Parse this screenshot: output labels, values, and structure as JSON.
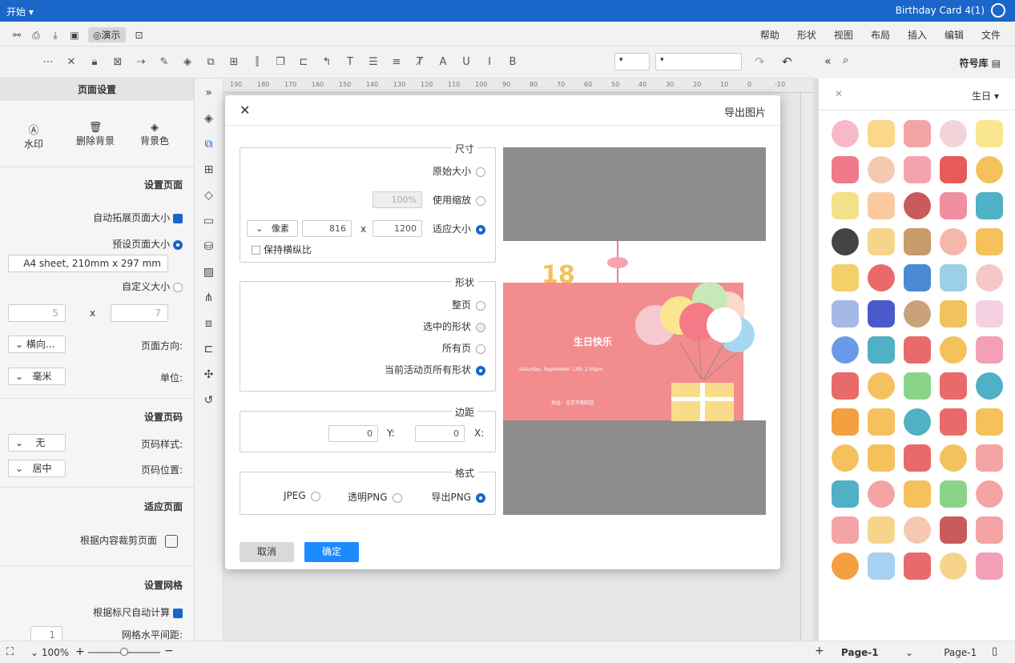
{
  "titlebar": {
    "left_label": "开始",
    "doc_title": "Birthday Card 4(1)"
  },
  "menubar": {
    "items": [
      "文件",
      "编辑",
      "插入",
      "布局",
      "视图",
      "形状",
      "帮助"
    ],
    "demo_label": "演示"
  },
  "toolbar": {
    "font_placeholder": ""
  },
  "library": {
    "title": "符号库",
    "category": "生日"
  },
  "left_panel": {
    "title": "页面设置",
    "bg_color": "背景色",
    "remove_bg": "删除背景",
    "watermark": "水印",
    "set_page": "设置页面",
    "auto_expand": "自动拓展页面大小",
    "preset_size": "预设页面大小",
    "preset_value": "A4 sheet, 210mm x 297 mm",
    "custom_size": "自定义大小",
    "custom_w": "7",
    "custom_h": "5",
    "orientation_label": "页面方向:",
    "orientation_value": "横向...",
    "unit_label": "单位:",
    "unit_value": "毫米",
    "page_number": "设置页码",
    "page_style_label": "页码样式:",
    "page_style_value": "无",
    "page_pos_label": "页码位置:",
    "page_pos_value": "居中",
    "fit_page": "适应页面",
    "crop_content": "根据内容裁剪页面",
    "grid": "设置网格",
    "auto_ruler": "根据标尺自动计算",
    "grid_spacing": "网格水平间距:",
    "grid_spacing_value": "1"
  },
  "dialog": {
    "title": "导出图片",
    "size_legend": "尺寸",
    "original_size": "原始大小",
    "use_scale": "使用缩放",
    "scale_value": "100%",
    "fit_size": "适应大小",
    "width": "1200",
    "height": "816",
    "unit": "像素",
    "keep_ratio": "保持横纵比",
    "shape_legend": "形状",
    "whole_page": "整页",
    "selected_shapes": "选中的形状",
    "all_pages": "所有页",
    "current_all_shapes": "当前活动页所有形状",
    "margin_legend": "边距",
    "margin_x_label": "X:",
    "margin_x": "0",
    "margin_y_label": "Y:",
    "margin_y": "0",
    "format_legend": "格式",
    "export_png": "导出PNG",
    "transparent_png": "透明PNG",
    "jpeg": "JPEG",
    "ok": "确定",
    "cancel": "取消",
    "card_title": "生日快乐",
    "card_sub": "Saturday, September 13th 2:00pm",
    "card_foot": "地址：北京市朝阳区",
    "card_number": "18"
  },
  "statusbar": {
    "page_tab": "Page-1",
    "page_select": "Page-1",
    "zoom": "100%"
  },
  "ruler": {
    "ticks": [
      "190",
      "180",
      "170",
      "160",
      "150",
      "140",
      "130",
      "120",
      "110",
      "100",
      "90",
      "80",
      "70",
      "60",
      "50",
      "40",
      "30",
      "20",
      "10",
      "0",
      "-10"
    ]
  },
  "colors": {
    "accent": "#1a66c9",
    "button": "#1a8cff",
    "card_pink": "#f28c8f"
  }
}
